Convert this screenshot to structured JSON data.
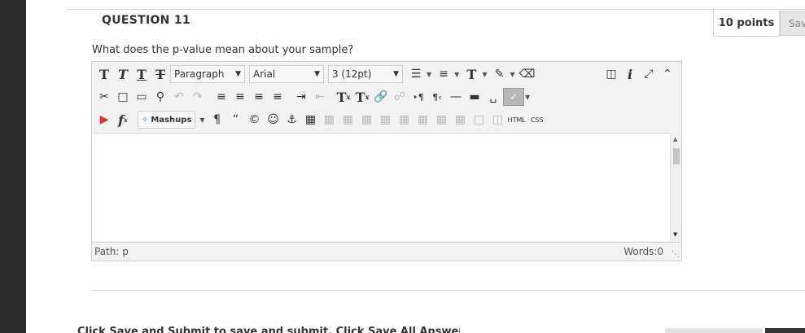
{
  "question": {
    "title": "QUESTION 11",
    "points": "10 points",
    "save_label": "Sav",
    "text": "What does the p-value mean about your sample?"
  },
  "editor": {
    "format_dropdown": "Paragraph",
    "font_dropdown": "Arial",
    "size_dropdown": "3 (12pt)",
    "mashups_label": "Mashups",
    "html_label": "HTML",
    "css_label": "CSS",
    "path_label": "Path: p",
    "words_label": "Words:0",
    "content": ""
  },
  "next_question": {
    "text": "Click Save and Submit to save and submit. Click Save All Answers to save all answers."
  }
}
